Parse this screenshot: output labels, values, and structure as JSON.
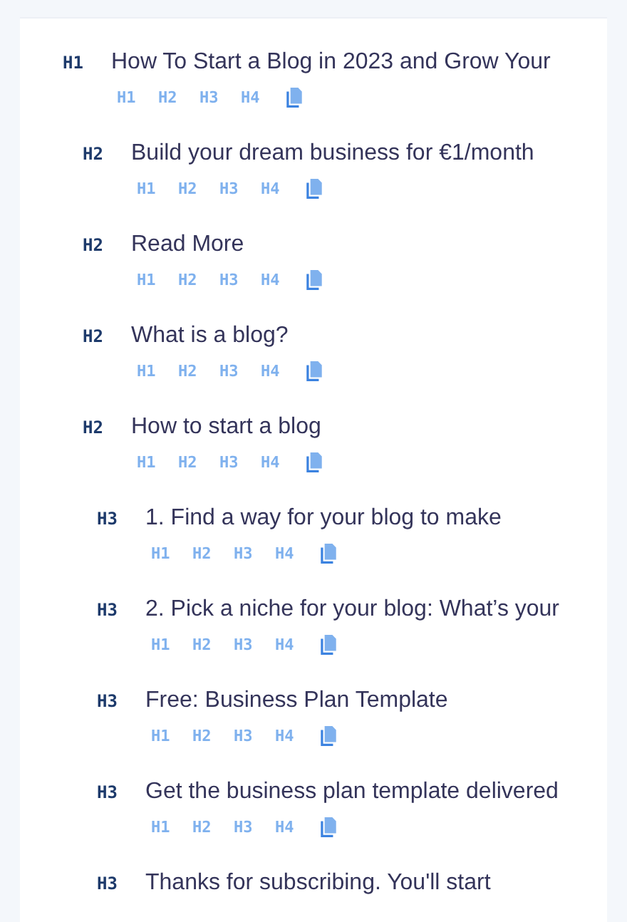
{
  "headings": [
    {
      "tag": "H1",
      "title": "How To Start a Blog in 2023 and Grow Your",
      "actions": [
        "H1",
        "H2",
        "H3",
        "H4"
      ],
      "children": [
        {
          "tag": "H2",
          "title": "Build your dream business for €1/month",
          "actions": [
            "H1",
            "H2",
            "H3",
            "H4"
          ]
        },
        {
          "tag": "H2",
          "title": "Read More",
          "actions": [
            "H1",
            "H2",
            "H3",
            "H4"
          ]
        },
        {
          "tag": "H2",
          "title": "What is a blog?",
          "actions": [
            "H1",
            "H2",
            "H3",
            "H4"
          ]
        },
        {
          "tag": "H2",
          "title": "How to start a blog",
          "actions": [
            "H1",
            "H2",
            "H3",
            "H4"
          ],
          "children": [
            {
              "tag": "H3",
              "title": "1. Find a way for your blog to make",
              "actions": [
                "H1",
                "H2",
                "H3",
                "H4"
              ]
            },
            {
              "tag": "H3",
              "title": "2. Pick a niche for your blog: What’s your",
              "actions": [
                "H1",
                "H2",
                "H3",
                "H4"
              ]
            },
            {
              "tag": "H3",
              "title": "Free: Business Plan Template",
              "actions": [
                "H1",
                "H2",
                "H3",
                "H4"
              ]
            },
            {
              "tag": "H3",
              "title": "Get the business plan template delivered",
              "actions": [
                "H1",
                "H2",
                "H3",
                "H4"
              ]
            },
            {
              "tag": "H3",
              "title": "Thanks for subscribing. You'll start"
            }
          ]
        }
      ]
    }
  ]
}
